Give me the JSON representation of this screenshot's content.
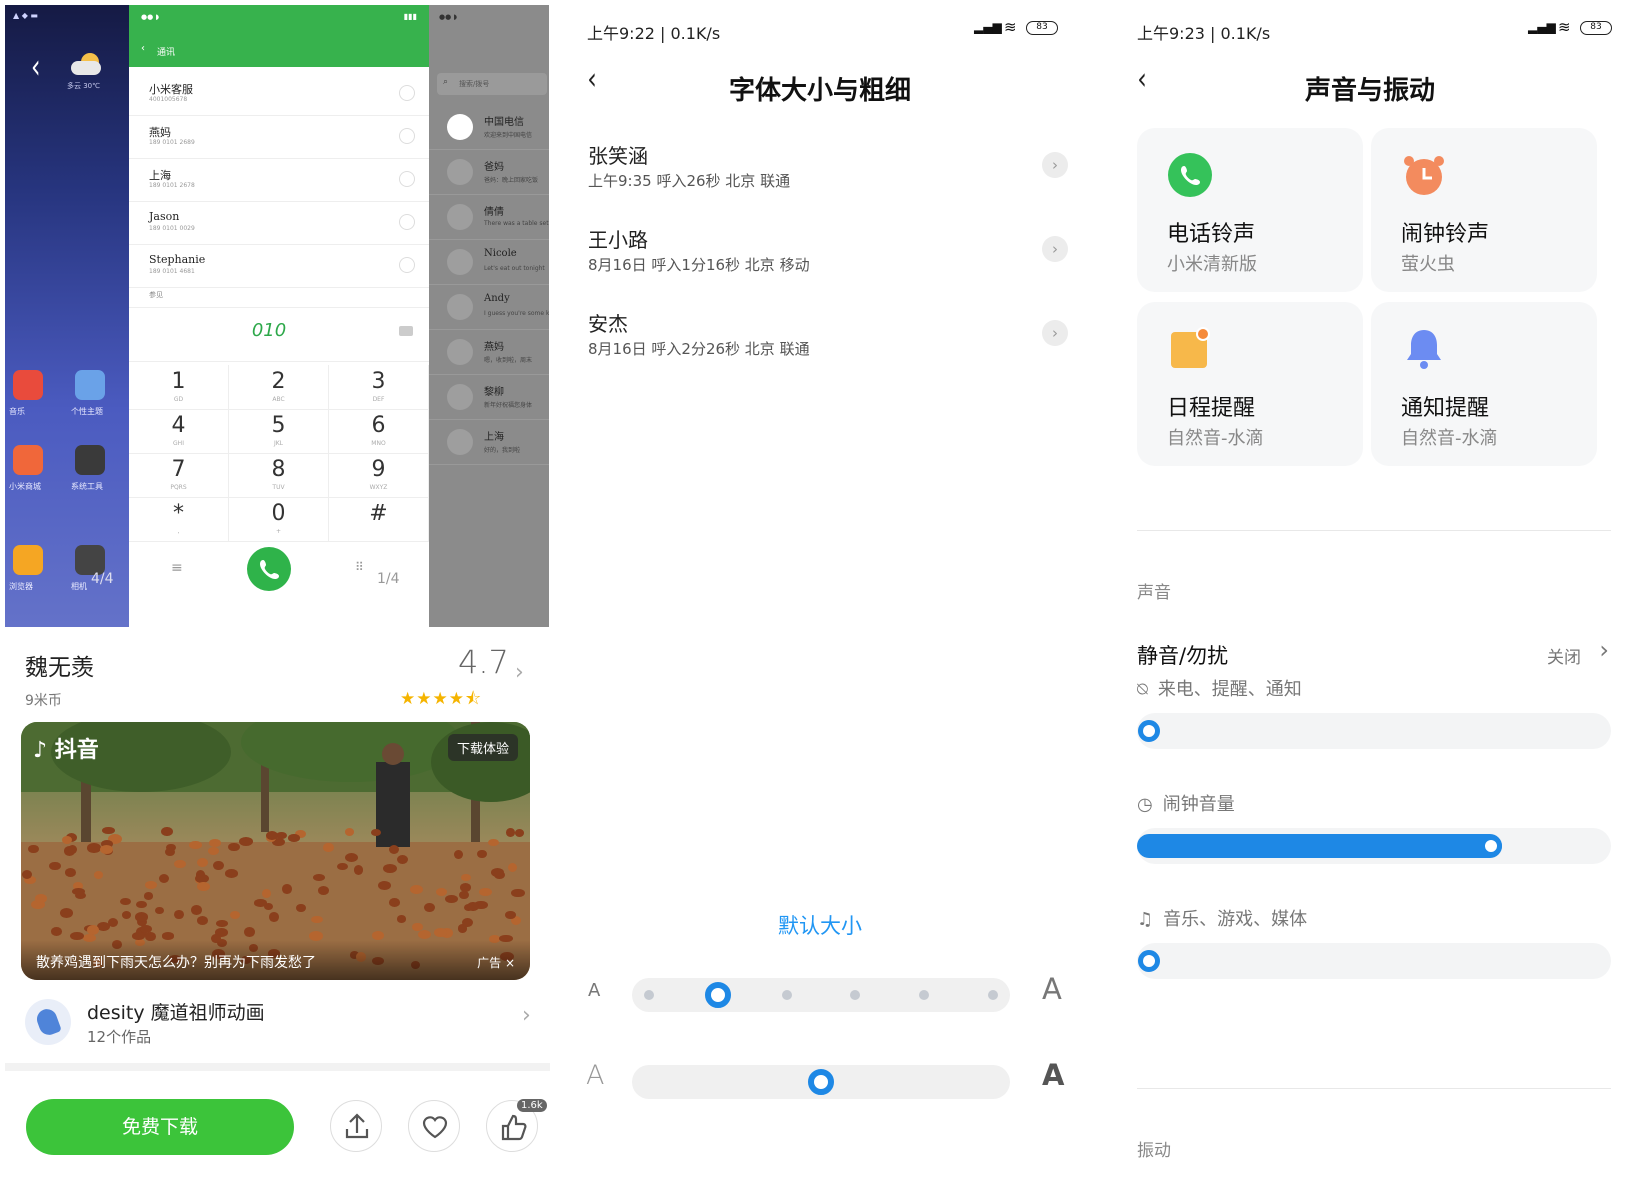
{
  "panel1": {
    "dialer": {
      "header_title": "通讯",
      "contacts": [
        {
          "name": "小米客服",
          "number": "4001005678"
        },
        {
          "name": "燕妈",
          "number": "189 0101 2689"
        },
        {
          "name": "上海",
          "number": "189 0101 2678"
        },
        {
          "name": "Jason",
          "number": "189 0101 0029"
        },
        {
          "name": "Stephanie",
          "number": "189 0101 4681"
        }
      ],
      "section_label": "参见",
      "input_value": "010",
      "keys": [
        {
          "d": "1",
          "l": "GD"
        },
        {
          "d": "2",
          "l": "ABC"
        },
        {
          "d": "3",
          "l": "DEF"
        },
        {
          "d": "4",
          "l": "GHI"
        },
        {
          "d": "5",
          "l": "JKL"
        },
        {
          "d": "6",
          "l": "MNO"
        },
        {
          "d": "7",
          "l": "PQRS"
        },
        {
          "d": "8",
          "l": "TUV"
        },
        {
          "d": "9",
          "l": "WXYZ"
        },
        {
          "d": "*",
          "l": ","
        },
        {
          "d": "0",
          "l": "+"
        },
        {
          "d": "#",
          "l": ""
        }
      ],
      "page_left": "4/4",
      "page_right": "1/4"
    },
    "home": {
      "weather": "多云 30℃",
      "apps": [
        {
          "label": "音乐",
          "color": "#e94b3c"
        },
        {
          "label": "个性主题",
          "color": "#6aa2e8"
        },
        {
          "label": "小米商城",
          "color": "#f0673a"
        },
        {
          "label": "系统工具",
          "color": "#3a3a3a"
        },
        {
          "label": "浏览器",
          "color": "#f5a623"
        },
        {
          "label": "相机",
          "color": "#444"
        }
      ]
    },
    "dim_list": {
      "search_placeholder": "搜索/拨号",
      "items": [
        {
          "t": "中国电信",
          "s": "欢迎来到中国电信"
        },
        {
          "t": "爸妈",
          "s": "爸妈：晚上回家吃饭"
        },
        {
          "t": "倩倩",
          "s": "There was a table set"
        },
        {
          "t": "Nicole",
          "s": "Let's eat out tonight"
        },
        {
          "t": "Andy",
          "s": "I guess you're some kind"
        },
        {
          "t": "燕妈",
          "s": "嗯，收到啦，周末"
        },
        {
          "t": "黎柳",
          "s": "新年好祝福您身体"
        },
        {
          "t": "上海",
          "s": "好的，我到啦"
        }
      ]
    },
    "app_name": "魏无羡",
    "rating": "4.7",
    "price": "9米币",
    "stars_value": 4.5,
    "video": {
      "brand": "抖音",
      "download_badge": "下载体验",
      "caption": "散养鸡遇到下雨天怎么办？别再为下雨发愁了",
      "ad_label": "广告 ×"
    },
    "developer": {
      "name": "desity 魔道祖师动画",
      "works": "12个作品"
    },
    "download_button": "免费下载",
    "like_count": "1.6k"
  },
  "panel2": {
    "status_time": "上午9:22 | 0.1K/s",
    "battery": "83",
    "title": "字体大小与粗细",
    "calls": [
      {
        "name": "张笑涵",
        "detail": "上午9:35 呼入26秒 北京 联通"
      },
      {
        "name": "王小路",
        "detail": "8月16日 呼入1分16秒 北京 移动"
      },
      {
        "name": "安杰",
        "detail": "8月16日 呼入2分26秒 北京 联通"
      }
    ],
    "size_label": "默认大小",
    "size_small": "A",
    "size_big": "A",
    "size_steps": 6,
    "size_selected_index": 1,
    "weight_value": 0.5
  },
  "panel3": {
    "status_time": "上午9:23 | 0.1K/s",
    "battery": "83",
    "title": "声音与振动",
    "cards": [
      {
        "title": "电话铃声",
        "sub": "小米清新版",
        "icon": "phone-icon",
        "color": "#35c25a"
      },
      {
        "title": "闹钟铃声",
        "sub": "萤火虫",
        "icon": "alarm-clock-icon",
        "color": "#f38b5e"
      },
      {
        "title": "日程提醒",
        "sub": "自然音-水滴",
        "icon": "calendar-icon",
        "color": "#f7b84a"
      },
      {
        "title": "通知提醒",
        "sub": "自然音-水滴",
        "icon": "bell-icon",
        "color": "#6c8cf2"
      }
    ],
    "sound_section": "声音",
    "dnd_label": "静音/勿扰",
    "dnd_value": "关闭",
    "volumes": [
      {
        "label": "来电、提醒、通知",
        "icon": "bell-off-icon",
        "value": 0.0
      },
      {
        "label": "闹钟音量",
        "icon": "alarm-icon",
        "value": 0.77
      },
      {
        "label": "音乐、游戏、媒体",
        "icon": "music-icon",
        "value": 0.0
      }
    ],
    "vibrate_section": "振动"
  }
}
